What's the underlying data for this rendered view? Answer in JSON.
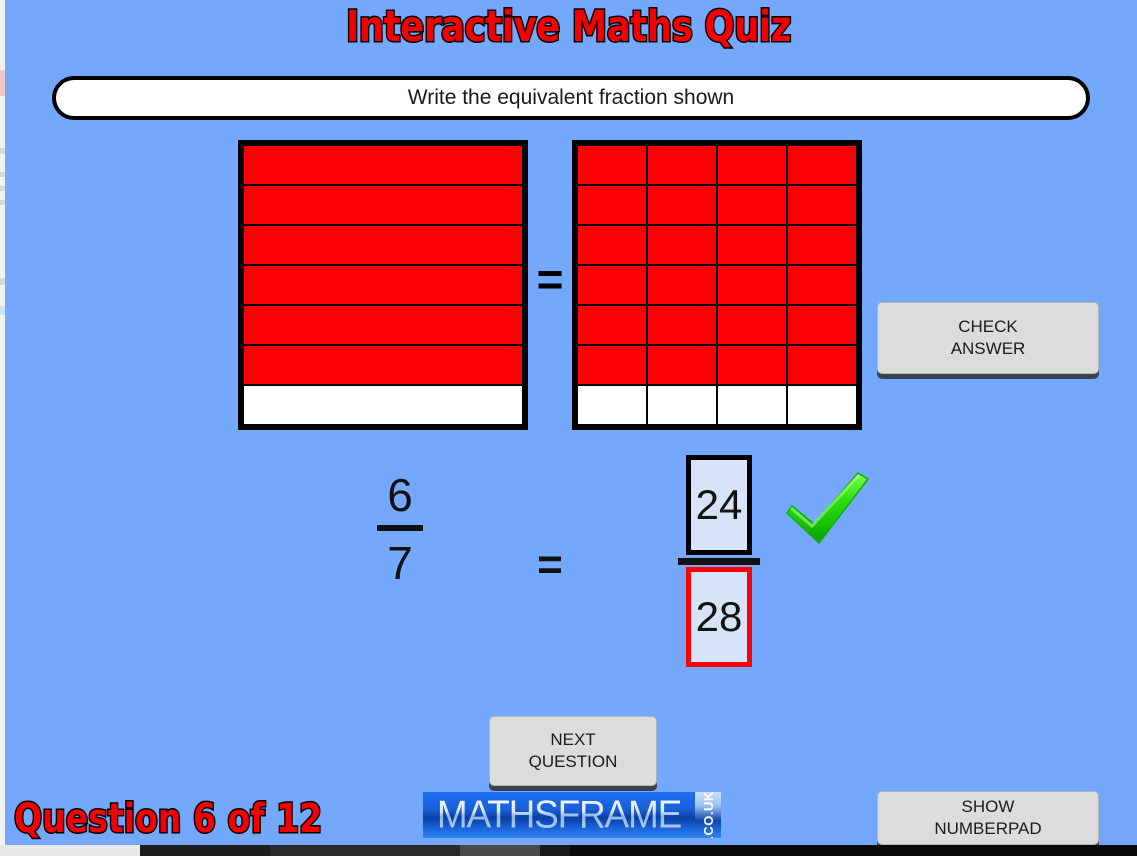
{
  "app": {
    "title": "Interactive Maths Quiz",
    "background_color": "#74a8fd",
    "accent_red": "#f50000",
    "fill_red": "#fb0007",
    "answer_field_fill": "#d7e3f8"
  },
  "question": {
    "prompt": "Write the equivalent fraction shown",
    "counter": "Question 6 of 12"
  },
  "diagram": {
    "equals_symbol": "=",
    "left_shape": {
      "name": "seven-row-bar",
      "rows": 7,
      "columns": 1,
      "total_cells": 7,
      "filled_cells": 6,
      "fraction": "6/7"
    },
    "right_shape": {
      "name": "seven-by-four-grid",
      "rows": 7,
      "columns": 4,
      "total_cells": 28,
      "filled_cells": 24,
      "fraction": "24/28"
    }
  },
  "equation": {
    "left_numerator": "6",
    "left_denominator": "7",
    "equals_symbol": "=",
    "answer_numerator": "24",
    "answer_denominator": "28",
    "numerator_border_color": "#000000",
    "denominator_border_color": "#fb0007",
    "feedback_icon": "green-tick-icon",
    "feedback_color": "#2ee10e"
  },
  "buttons": {
    "check_answer": {
      "line1": "CHECK",
      "line2": "ANSWER"
    },
    "next_question": {
      "line1": "NEXT",
      "line2": "QUESTION"
    },
    "show_numberpad": {
      "line1": "SHOW",
      "line2": "NUMBERPAD"
    }
  },
  "logo": {
    "name": "MATHSFRAME",
    "domain": ".CO.UK"
  }
}
